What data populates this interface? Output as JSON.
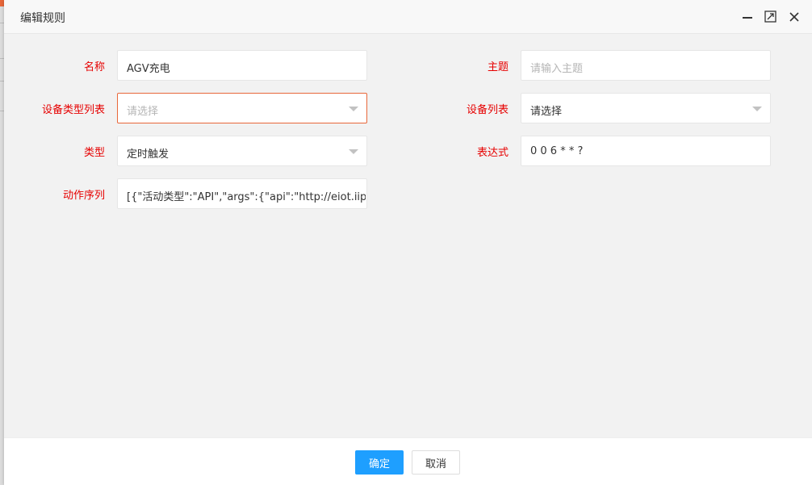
{
  "dialog": {
    "title": "编辑规则"
  },
  "form": {
    "name": {
      "label": "名称",
      "value": "AGV充电"
    },
    "topic": {
      "label": "主题",
      "placeholder": "请输入主题"
    },
    "device_type_list": {
      "label": "设备类型列表",
      "placeholder": "请选择"
    },
    "device_list": {
      "label": "设备列表",
      "value": "请选择"
    },
    "type": {
      "label": "类型",
      "value": "定时触发"
    },
    "expression": {
      "label": "表达式",
      "value": "0 0 6 * * ?"
    },
    "action_sequence": {
      "label": "动作序列",
      "value": "[{\"活动类型\":\"API\",\"args\":{\"api\":\"http://eiot.iipcloud"
    }
  },
  "footer": {
    "confirm_label": "确定",
    "cancel_label": "取消"
  },
  "colors": {
    "required_label": "#e60000",
    "primary_button": "#1e9fff",
    "focus_border": "#e8673a"
  },
  "icons": {
    "minimize": "minimize-icon",
    "maximize": "maximize-icon",
    "close": "close-icon",
    "dropdown": "caret-down-icon"
  }
}
